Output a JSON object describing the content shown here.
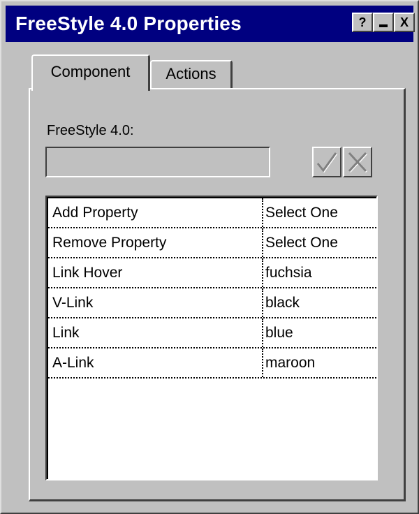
{
  "window": {
    "title": "FreeStyle 4.0 Properties",
    "buttons": {
      "help": "?",
      "minimize": "_",
      "close": "X"
    }
  },
  "tabs": [
    {
      "label": "Component",
      "selected": true
    },
    {
      "label": "Actions",
      "selected": false
    }
  ],
  "field": {
    "label": "FreeStyle 4.0:",
    "value": ""
  },
  "properties": [
    {
      "name": "Add Property",
      "value": "Select One"
    },
    {
      "name": "Remove Property",
      "value": "Select One"
    },
    {
      "name": "Link Hover",
      "value": "fuchsia"
    },
    {
      "name": "V-Link",
      "value": "black"
    },
    {
      "name": "Link",
      "value": "blue"
    },
    {
      "name": "A-Link",
      "value": "maroon"
    }
  ],
  "colors": {
    "titlebar": "#000080",
    "face": "#c0c0c0",
    "highlight": "#ffffff",
    "shadow": "#404040",
    "disabled_glyph": "#808080"
  },
  "icons": {
    "accept": "checkmark-icon",
    "cancel": "x-mark-icon"
  }
}
